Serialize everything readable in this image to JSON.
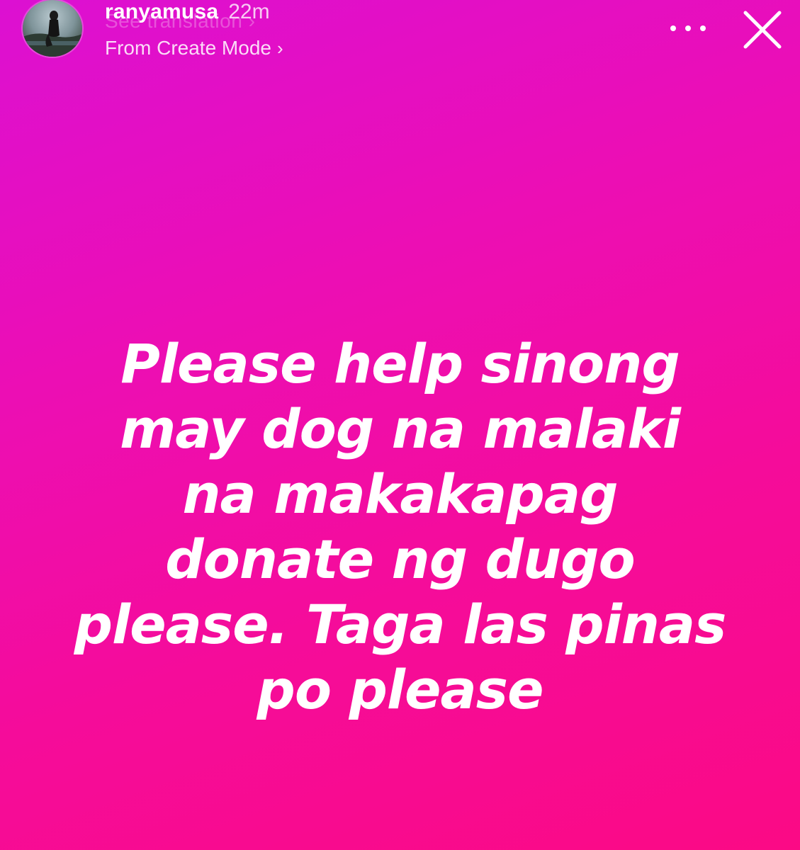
{
  "header": {
    "username": "ranyamusa",
    "time_ago": "22m",
    "ghost_text": "See translation",
    "ghost_chevron": "›",
    "source_label": "From Create Mode",
    "source_chevron": "›",
    "more_icon": "more-horizontal-icon",
    "close_icon": "close-icon"
  },
  "story": {
    "background_colors": [
      "#dc10d2",
      "#fb0a85"
    ],
    "lines": [
      "Please help sinong",
      "may dog na malaki",
      "na makakapag",
      "donate ng dugo",
      "please. Taga las pinas",
      "po please"
    ]
  }
}
